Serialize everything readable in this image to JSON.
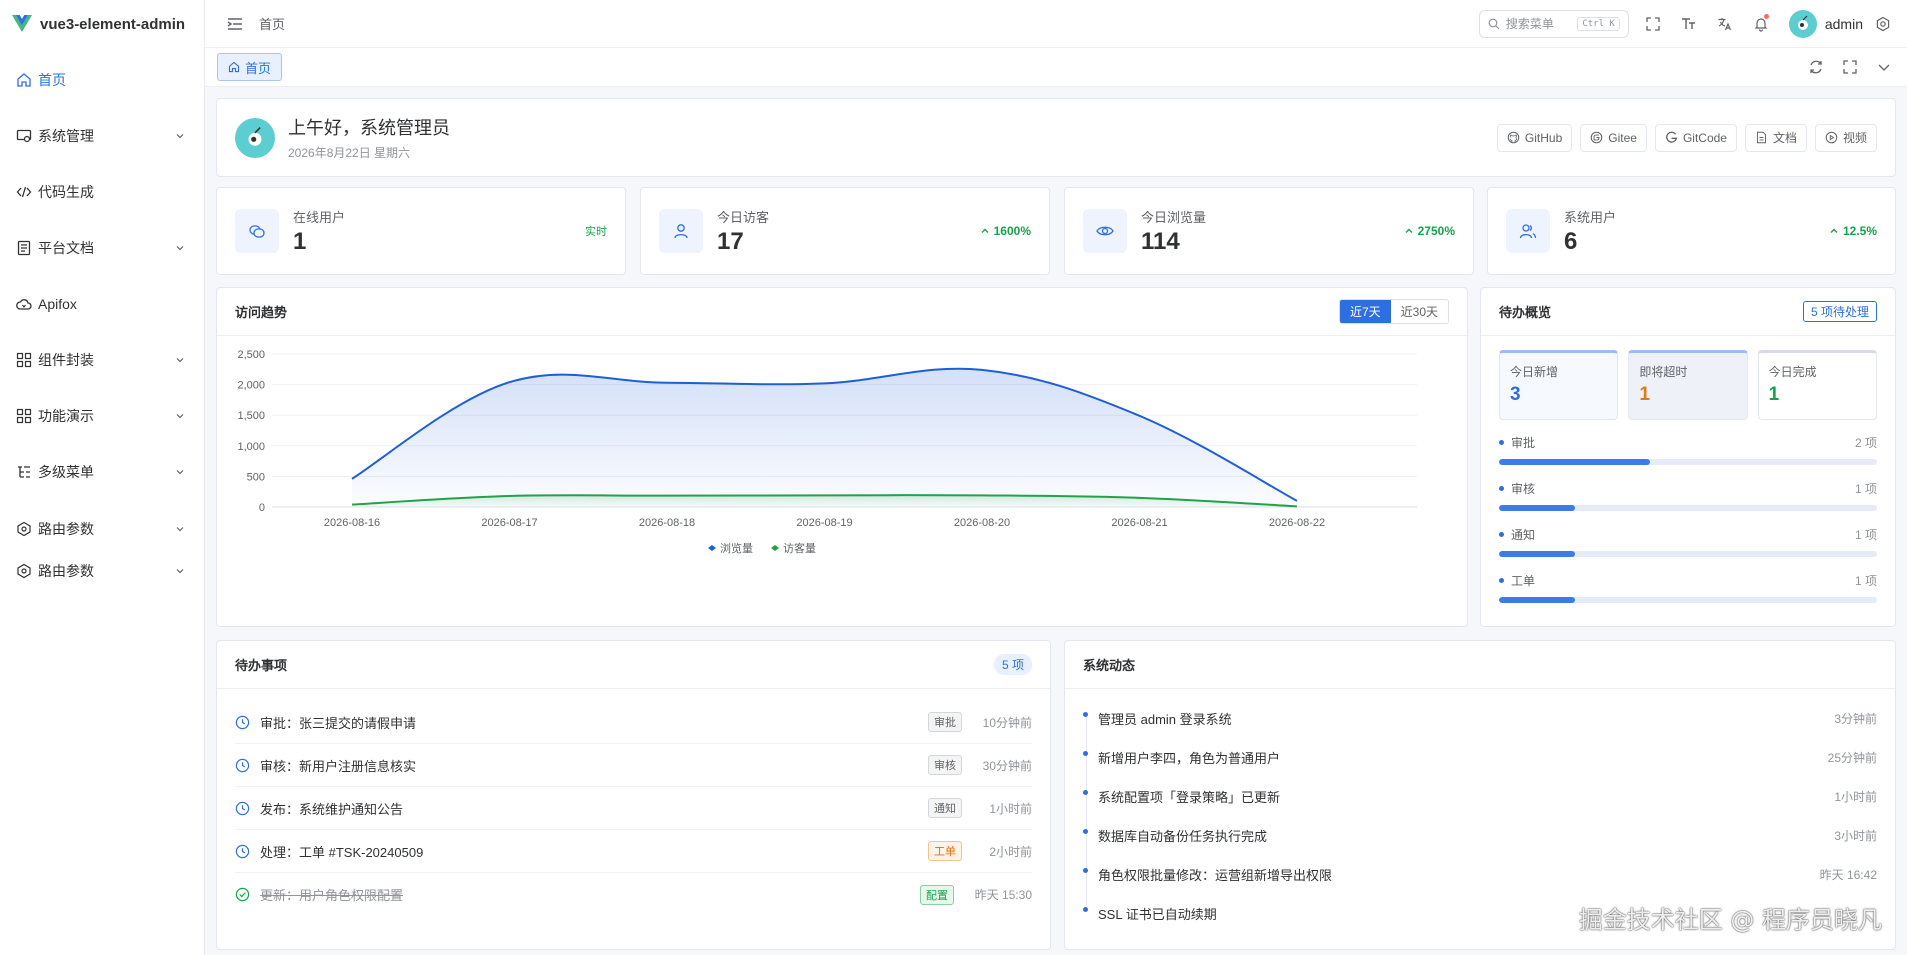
{
  "app": {
    "title": "vue3-element-admin"
  },
  "sidebar": {
    "items": [
      {
        "label": "首页",
        "icon": "home-icon",
        "active": true,
        "has_children": false
      },
      {
        "label": "系统管理",
        "icon": "system-icon",
        "has_children": true
      },
      {
        "label": "代码生成",
        "icon": "code-icon",
        "has_children": false
      },
      {
        "label": "平台文档",
        "icon": "document-icon",
        "has_children": true
      },
      {
        "label": "Apifox",
        "icon": "cloud-icon",
        "has_children": false
      },
      {
        "label": "组件封装",
        "icon": "grid-icon",
        "has_children": true
      },
      {
        "label": "功能演示",
        "icon": "grid-icon",
        "has_children": true
      },
      {
        "label": "多级菜单",
        "icon": "tree-icon",
        "has_children": true
      },
      {
        "label": "路由参数",
        "icon": "route-icon",
        "has_children": true
      },
      {
        "label": "路由参数",
        "icon": "route-icon",
        "has_children": true
      }
    ]
  },
  "header": {
    "breadcrumb": "首页",
    "search_placeholder": "搜索菜单",
    "search_shortcut": "Ctrl K",
    "username": "admin"
  },
  "tags": {
    "home": "首页"
  },
  "welcome": {
    "greeting": "上午好，系统管理员",
    "date": "2026年8月22日 星期六",
    "links": [
      "GitHub",
      "Gitee",
      "GitCode",
      "文档",
      "视频"
    ]
  },
  "stats": [
    {
      "label": "在线用户",
      "value": "1",
      "trend": "实时",
      "icon": "chat-icon"
    },
    {
      "label": "今日访客",
      "value": "17",
      "trend": "1600%",
      "icon": "user-icon"
    },
    {
      "label": "今日浏览量",
      "value": "114",
      "trend": "2750%",
      "icon": "eye-icon"
    },
    {
      "label": "系统用户",
      "value": "6",
      "trend": "12.5%",
      "icon": "users-icon"
    }
  ],
  "trend_card": {
    "title": "访问趋势",
    "range_options": [
      "近7天",
      "近30天"
    ],
    "selected": "近7天"
  },
  "chart_data": {
    "type": "area",
    "x": [
      "2026-08-16",
      "2026-08-17",
      "2026-08-18",
      "2026-08-19",
      "2026-08-20",
      "2026-08-21",
      "2026-08-22"
    ],
    "series": [
      {
        "name": "浏览量",
        "values": [
          460,
          2040,
          2030,
          2020,
          2240,
          1490,
          100
        ],
        "color": "#1f5fd6"
      },
      {
        "name": "访客量",
        "values": [
          40,
          180,
          185,
          190,
          190,
          150,
          10
        ],
        "color": "#22a34a"
      }
    ],
    "yticks": [
      "0",
      "500",
      "1,000",
      "1,500",
      "2,000",
      "2,500"
    ],
    "ylim": [
      0,
      2500
    ],
    "legend": "bottom"
  },
  "overview": {
    "title": "待办概览",
    "badge": "5 项待处理",
    "tiles": [
      {
        "label": "今日新增",
        "value": "3",
        "color": "#2d6fe0"
      },
      {
        "label": "即将超时",
        "value": "1",
        "color": "#e6770b"
      },
      {
        "label": "今日完成",
        "value": "1",
        "color": "#16a34a"
      }
    ],
    "rows": [
      {
        "label": "审批",
        "count": "2 项",
        "fraction": 0.4
      },
      {
        "label": "审核",
        "count": "1 项",
        "fraction": 0.2
      },
      {
        "label": "通知",
        "count": "1 项",
        "fraction": 0.2
      },
      {
        "label": "工单",
        "count": "1 项",
        "fraction": 0.2
      }
    ]
  },
  "todos": {
    "title": "待办事项",
    "count_badge": "5 项",
    "items": [
      {
        "text": "审批：张三提交的请假申请",
        "tag": "审批",
        "time": "10分钟前",
        "done": false,
        "tag_style": "gray"
      },
      {
        "text": "审核：新用户注册信息核实",
        "tag": "审核",
        "time": "30分钟前",
        "done": false,
        "tag_style": "gray"
      },
      {
        "text": "发布：系统维护通知公告",
        "tag": "通知",
        "time": "1小时前",
        "done": false,
        "tag_style": "gray"
      },
      {
        "text": "处理：工单 #TSK-20240509",
        "tag": "工单",
        "time": "2小时前",
        "done": false,
        "tag_style": "orange"
      },
      {
        "text": "更新：用户角色权限配置",
        "tag": "配置",
        "time": "昨天 15:30",
        "done": true,
        "tag_style": "green"
      }
    ]
  },
  "feed": {
    "title": "系统动态",
    "items": [
      {
        "text": "管理员 admin 登录系统",
        "time": "3分钟前"
      },
      {
        "text": "新增用户李四，角色为普通用户",
        "time": "25分钟前"
      },
      {
        "text": "系统配置项「登录策略」已更新",
        "time": "1小时前"
      },
      {
        "text": "数据库自动备份任务执行完成",
        "time": "3小时前"
      },
      {
        "text": "角色权限批量修改：运营组新增导出权限",
        "time": "昨天 16:42"
      },
      {
        "text": "SSL 证书已自动续期",
        "time": ""
      }
    ]
  },
  "watermark": "掘金技术社区 @ 程序员晓凡"
}
